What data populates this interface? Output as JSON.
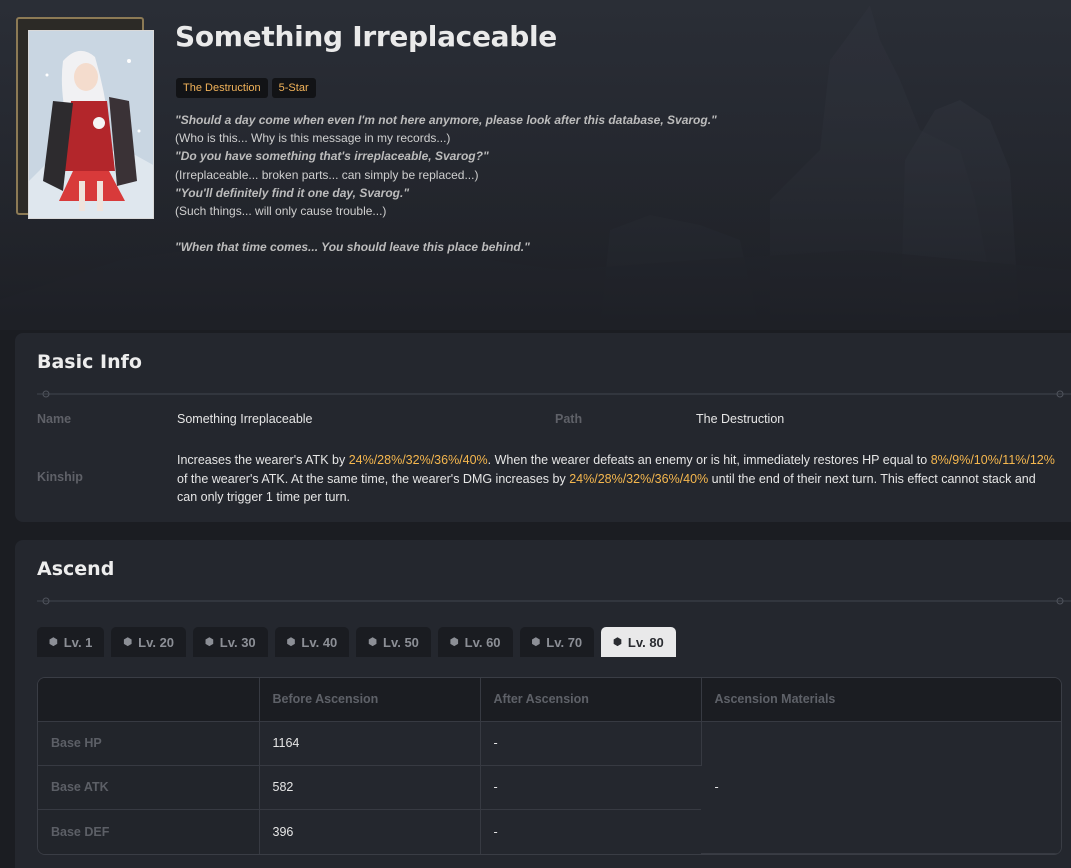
{
  "lightcone": {
    "title": "Something Irreplaceable",
    "badges": [
      "The Destruction",
      "5-Star"
    ],
    "quotes": [
      {
        "text": "\"Should a day come when even I'm not here anymore, please look after this database, Svarog.\"",
        "style": "q"
      },
      {
        "text": "(Who is this... Why is this message in my records...)",
        "style": "n"
      },
      {
        "text": "\"Do you have something that's irreplaceable, Svarog?\"",
        "style": "q"
      },
      {
        "text": "(Irreplaceable... broken parts... can simply be replaced...)",
        "style": "n"
      },
      {
        "text": "\"You'll definitely find it one day, Svarog.\"",
        "style": "q"
      },
      {
        "text": "(Such things... will only cause trouble...)",
        "style": "n"
      },
      {
        "text": "",
        "style": "gap"
      },
      {
        "text": "\"When that time comes... You should leave this place behind.\"",
        "style": "q"
      }
    ]
  },
  "basic_info": {
    "heading": "Basic Info",
    "name_label": "Name",
    "name_value": "Something Irreplaceable",
    "path_label": "Path",
    "path_value": "The Destruction",
    "kinship_label": "Kinship",
    "kinship_parts": [
      {
        "t": "Increases the wearer's ATK by ",
        "hl": false
      },
      {
        "t": "24%/28%/32%/36%/40%",
        "hl": true
      },
      {
        "t": ". When the wearer defeats an enemy or is hit, immediately restores HP equal to ",
        "hl": false
      },
      {
        "t": "8%/9%/10%/11%/12%",
        "hl": true
      },
      {
        "t": " of the wearer's ATK. At the same time, the wearer's DMG increases by ",
        "hl": false
      },
      {
        "t": "24%/28%/32%/36%/40%",
        "hl": true
      },
      {
        "t": " until the end of their next turn. This effect cannot stack and can only trigger 1 time per turn.",
        "hl": false
      }
    ]
  },
  "ascend": {
    "heading": "Ascend",
    "tabs": [
      "Lv. 1",
      "Lv. 20",
      "Lv. 30",
      "Lv. 40",
      "Lv. 50",
      "Lv. 60",
      "Lv. 70",
      "Lv. 80"
    ],
    "active_tab": 7,
    "columns": [
      "",
      "Before Ascension",
      "After Ascension",
      "Ascension Materials"
    ],
    "rows": [
      {
        "label": "Base HP",
        "before": "1164",
        "after": "-"
      },
      {
        "label": "Base ATK",
        "before": "582",
        "after": "-"
      },
      {
        "label": "Base DEF",
        "before": "396",
        "after": "-"
      }
    ],
    "materials": "-"
  },
  "colors": {
    "accent": "#f5b74e",
    "badge_text": "#f2b35a",
    "panel": "#24272e",
    "page_bg": "#1b1d22"
  },
  "icons": {
    "tab_icon": "cube-icon",
    "divider_ends": "diamond-icon"
  }
}
